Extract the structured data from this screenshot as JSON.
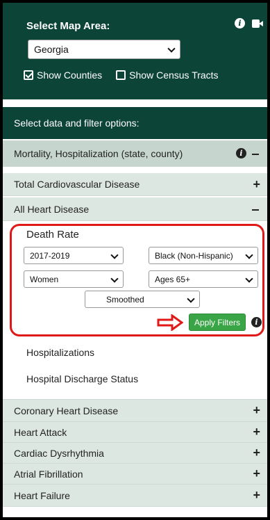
{
  "header": {
    "title": "Select Map Area:",
    "map_area_value": "Georgia",
    "show_counties_label": "Show Counties",
    "show_counties_checked": true,
    "show_census_label": "Show Census Tracts",
    "show_census_checked": false
  },
  "filter_section": {
    "title": "Select data and filter options:"
  },
  "mortality": {
    "label": "Mortality, Hospitalization (state, county)"
  },
  "items": {
    "total_cvd": "Total Cardiovascular Disease",
    "all_heart": "All Heart Disease",
    "coronary": "Coronary Heart Disease",
    "heart_attack": "Heart Attack",
    "dysrhythmia": "Cardiac Dysrhythmia",
    "afib": "Atrial Fibrillation",
    "heart_failure": "Heart Failure"
  },
  "death_rate": {
    "title": "Death Rate",
    "years": "2017-2019",
    "race": "Black (Non-Hispanic)",
    "sex": "Women",
    "age": "Ages 65+",
    "smoothing": "Smoothed",
    "apply_label": "Apply Filters"
  },
  "subitems": {
    "hospitalizations": "Hospitalizations",
    "discharge": "Hospital Discharge Status"
  },
  "colors": {
    "header_bg": "#0d4438",
    "apply_bg": "#3aa546",
    "highlight_red": "#e01818"
  }
}
